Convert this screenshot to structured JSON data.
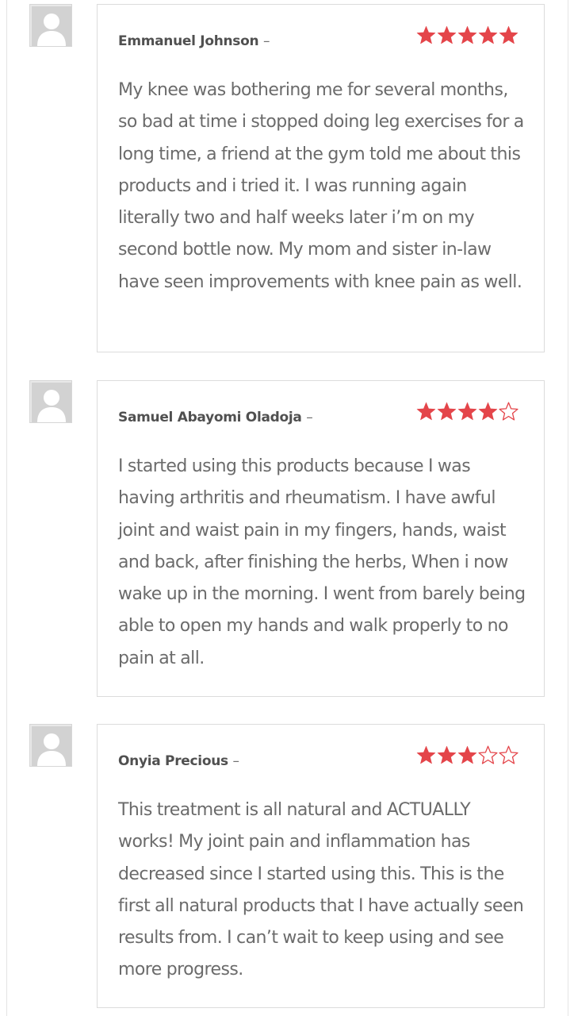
{
  "colors": {
    "star_fill": "#e4454a",
    "author_text": "#505050",
    "body_text": "#6b6b6b",
    "border": "#dcdcdc"
  },
  "reviews": [
    {
      "author": "Emmanuel Johnson",
      "separator": "–",
      "rating": 5,
      "max_rating": 5,
      "text": "My knee was bothering me for several months, so bad at time i stopped doing leg exercises for a long time, a friend at the gym told me about this products and i tried it. I was running again literally two and half weeks later i’m on my second bottle now. My mom and sister in-law have seen improvements with knee pain as well."
    },
    {
      "author": "Samuel Abayomi Oladoja",
      "separator": "–",
      "rating": 4,
      "max_rating": 5,
      "text": "I started using this products because I was having arthritis and rheumatism. I have awful joint and waist pain in my fingers, hands, waist and back, after finishing the herbs, When i now wake up in the morning. I went from barely being able to open my hands and walk properly to no pain at all."
    },
    {
      "author": "Onyia Precious",
      "separator": "–",
      "rating": 3,
      "max_rating": 5,
      "text": "This treatment is all natural and ACTUALLY works! My joint pain and inflammation has decreased since I started using this. This is the first all natural products that I have actually seen results from. I can’t wait to keep using and see more progress."
    }
  ]
}
